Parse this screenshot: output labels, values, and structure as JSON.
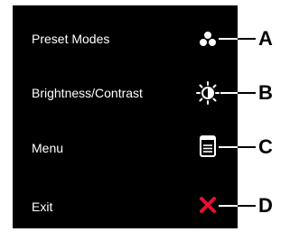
{
  "osd_menu": {
    "items": [
      {
        "label": "Preset Modes",
        "icon": "preset-modes-icon",
        "callout": "A"
      },
      {
        "label": "Brightness/Contrast",
        "icon": "brightness-icon",
        "callout": "B"
      },
      {
        "label": "Menu",
        "icon": "menu-icon",
        "callout": "C"
      },
      {
        "label": "Exit",
        "icon": "exit-icon",
        "callout": "D"
      }
    ]
  },
  "colors": {
    "panel": "#000000",
    "text": "#ffffff",
    "exit_icon": "#e8112d",
    "callout": "#000000"
  }
}
